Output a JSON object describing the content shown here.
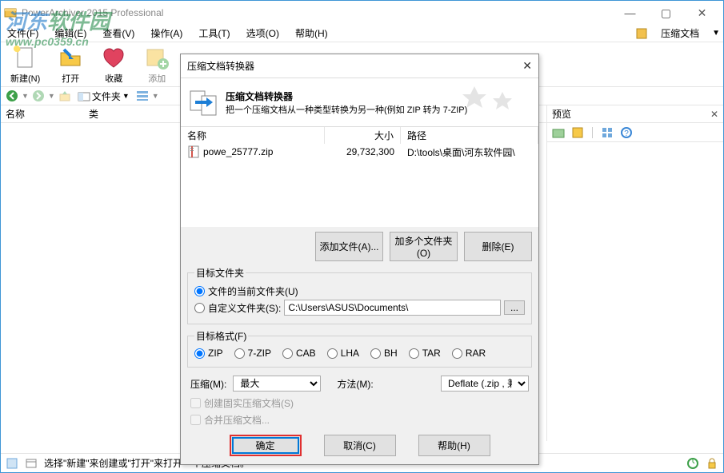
{
  "app": {
    "title": "PowerArchiver 2015 Professional"
  },
  "menu": {
    "file": "文件(F)",
    "edit": "编辑(E)",
    "view": "查看(V)",
    "action": "操作(A)",
    "tool": "工具(T)",
    "option": "选项(O)",
    "help": "帮助(H)",
    "compress": "压缩文档"
  },
  "toolbar": {
    "new": "新建(N)",
    "open": "打开",
    "fav": "收藏",
    "add": "添加"
  },
  "nav": {
    "folders": "文件夹"
  },
  "columns": {
    "name": "名称",
    "type": "类"
  },
  "preview": {
    "title": "预览"
  },
  "status": {
    "text": "选择\"新建\"来创建或\"打开\"来打开一个压缩文档。"
  },
  "watermark": {
    "line1a": "河东",
    "line1b": "软件园",
    "line2": "www.pc0359.cn"
  },
  "dialog": {
    "title": "压缩文档转换器",
    "header": {
      "title": "压缩文档转换器",
      "sub": "把一个压缩文档从一种类型转换为另一种(例如 ZIP 转为 7-ZIP)"
    },
    "listCols": {
      "name": "名称",
      "size": "大小",
      "path": "路径"
    },
    "listRow": {
      "filename": "powe_25777.zip",
      "size": "29,732,300",
      "path": "D:\\tools\\桌面\\河东软件园\\"
    },
    "btns": {
      "addFile": "添加文件(A)...",
      "addMore": "加多个文件夹(O)",
      "delete": "删除(E)"
    },
    "target": {
      "legend": "目标文件夹",
      "radio1": "文件的当前文件夹(U)",
      "radio2": "自定义文件夹(S):",
      "path": "C:\\Users\\ASUS\\Documents\\",
      "browse": "..."
    },
    "format": {
      "legend": "目标格式(F)",
      "zip": "ZIP",
      "sevenzip": "7-ZIP",
      "cab": "CAB",
      "lha": "LHA",
      "bh": "BH",
      "tar": "TAR",
      "rar": "RAR"
    },
    "compress": {
      "label": "压缩(M):",
      "value": "最大",
      "methodLabel": "方法(M):",
      "methodValue": "Deflate (.zip , 兼"
    },
    "check1": "创建固实压缩文档(S)",
    "check2": "合并压缩文档...",
    "bottom": {
      "ok": "确定",
      "cancel": "取消(C)",
      "help": "帮助(H)"
    }
  }
}
